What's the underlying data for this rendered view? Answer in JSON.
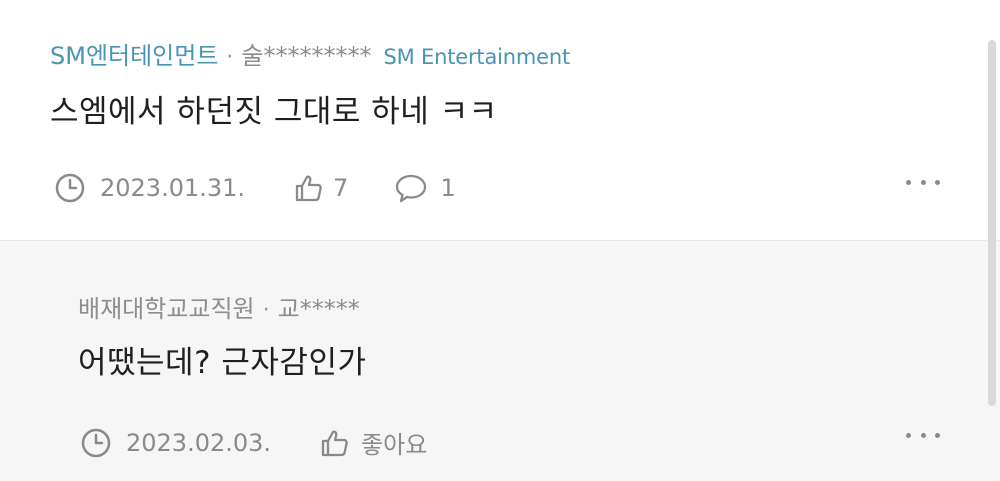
{
  "comment": {
    "author": "SM엔터테인먼트",
    "separator": "·",
    "masked_name": "술*********",
    "company": "SM Entertainment",
    "text": "스엠에서 하던짓 그대로 하네 ㅋㅋ",
    "date": "2023.01.31.",
    "like_count": "7",
    "reply_count": "1"
  },
  "reply": {
    "author": "배재대학교교직원",
    "separator": "·",
    "masked_name": "교*****",
    "text": "어땠는데? 근자감인가",
    "date": "2023.02.03.",
    "like_label": "좋아요"
  },
  "icons": {
    "clock": "clock-icon",
    "like": "thumbs-up-icon",
    "reply": "speech-bubble-icon",
    "more": "more-horizontal-icon"
  },
  "colors": {
    "author_link": "#4a95b4",
    "muted": "#8a8a8a",
    "reply_bg": "#f6f6f6",
    "text": "#1f1f1f"
  }
}
